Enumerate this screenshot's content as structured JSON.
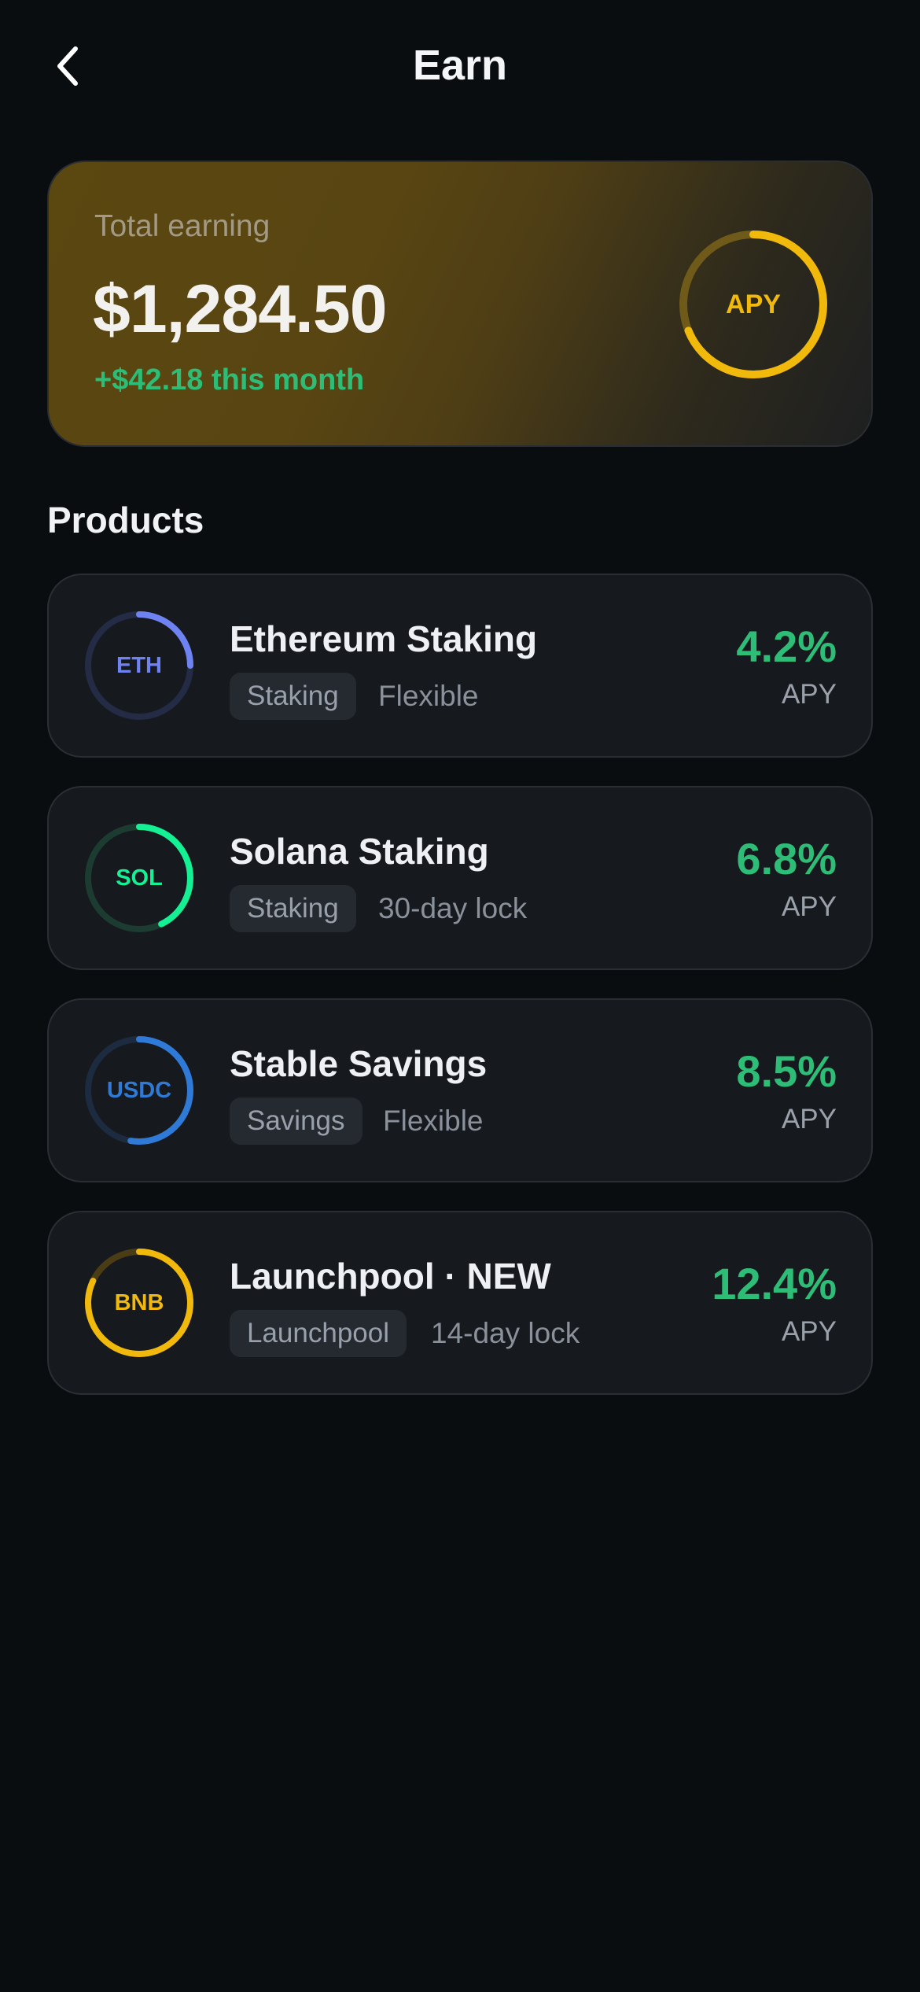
{
  "header": {
    "title": "Earn",
    "back_icon": "chevron-left-icon"
  },
  "summary": {
    "label": "Total earning",
    "amount": "$1,284.50",
    "delta": "+$42.18 this month",
    "ring_label": "APY",
    "accent_color": "#f0b90b",
    "positive_color": "#2ebd77"
  },
  "products_section": {
    "title": "Products"
  },
  "products": [
    {
      "coin": "ETH",
      "name": "Ethereum Staking",
      "tag": "Staking",
      "term": "Flexible",
      "rate": "4.2%",
      "rate_label": "APY",
      "color": "#6f82f2"
    },
    {
      "coin": "SOL",
      "name": "Solana Staking",
      "tag": "Staking",
      "term": "30-day lock",
      "rate": "6.8%",
      "rate_label": "APY",
      "color": "#14f195"
    },
    {
      "coin": "USDC",
      "name": "Stable Savings",
      "tag": "Savings",
      "term": "Flexible",
      "rate": "8.5%",
      "rate_label": "APY",
      "color": "#2f7ad6"
    },
    {
      "coin": "BNB",
      "name": "Launchpool · NEW",
      "tag": "Launchpool",
      "term": "14-day lock",
      "rate": "12.4%",
      "rate_label": "APY",
      "color": "#f0b90b"
    }
  ]
}
